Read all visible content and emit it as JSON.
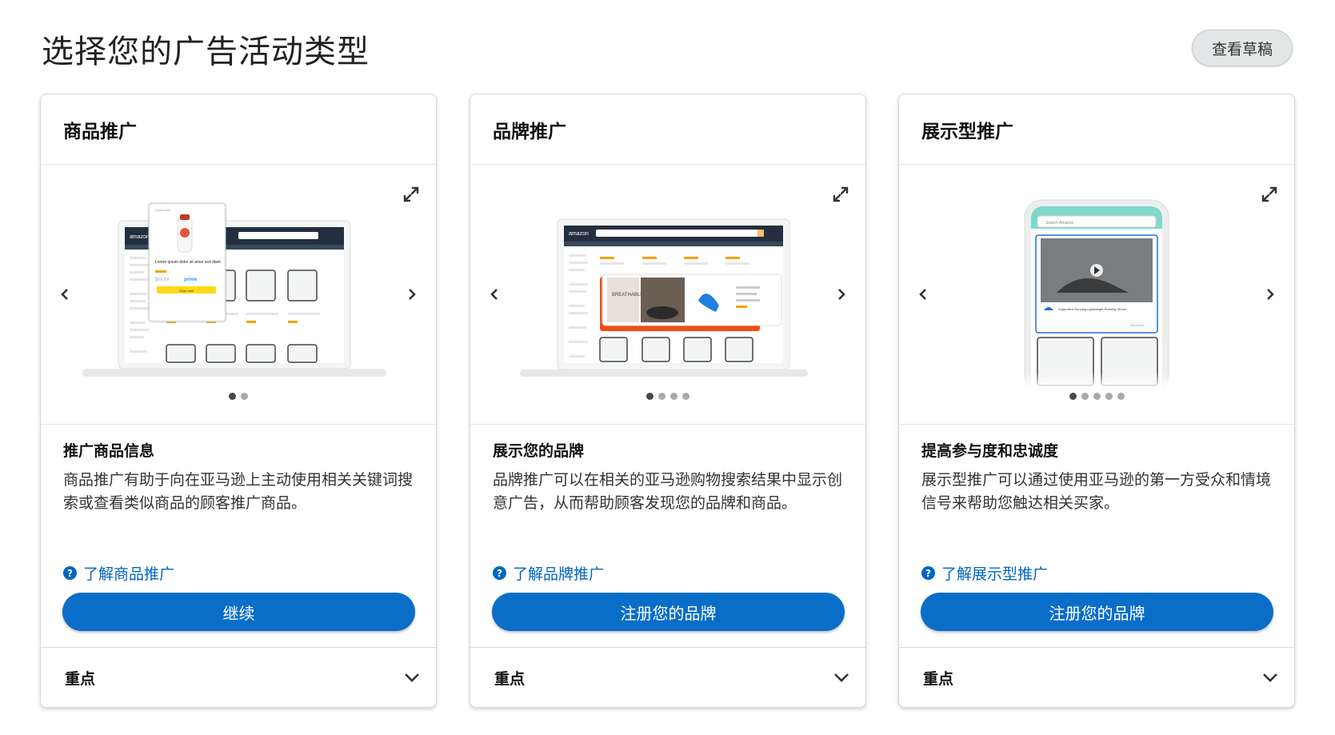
{
  "page": {
    "title": "选择您的广告活动类型",
    "draft_button": "查看草稿"
  },
  "cards": [
    {
      "title": "商品推广",
      "subtitle": "推广商品信息",
      "description": "商品推广有助于向在亚马逊上主动使用相关关键词搜索或查看类似商品的顾客推广商品。",
      "learn_link": "了解商品推广",
      "button": "继续",
      "footer": "重点",
      "slides": 2,
      "active_slide": 0,
      "illustration": {
        "product_label": "Sponsored",
        "product_name": "Lorem ipsum dolor sit amet sed diam",
        "price": "$XX.XX",
        "prime": "prime",
        "button": "Shop now",
        "brand": "amazon"
      }
    },
    {
      "title": "品牌推广",
      "subtitle": "展示您的品牌",
      "description": "品牌推广可以在相关的亚马逊购物搜索结果中显示创意广告，从而帮助顾客发现您的品牌和商品。",
      "learn_link": "了解品牌推广",
      "button": "注册您的品牌",
      "footer": "重点",
      "slides": 4,
      "active_slide": 0,
      "illustration": {
        "brand": "amazon",
        "headline": "BREATHABLE COMFORT"
      }
    },
    {
      "title": "展示型推广",
      "subtitle": "提高参与度和忠诚度",
      "description": "展示型推广可以通过使用亚马逊的第一方受众和情境信号来帮助您触达相关买家。",
      "learn_link": "了解展示型推广",
      "button": "注册您的品牌",
      "footer": "重点",
      "slides": 5,
      "active_slide": 0,
      "illustration": {
        "search_placeholder": "Search Amazon",
        "product_name": "Supportive Running Lightweight Running Shoes",
        "sponsored": "Sponsored"
      }
    }
  ],
  "colors": {
    "primary": "#0a6ec9",
    "link": "#0066c0",
    "orange": "#f04e12",
    "teal": "#7fd8cc"
  },
  "icons": {
    "expand": "expand-icon",
    "prev": "chevron-left-icon",
    "next": "chevron-right-icon",
    "help": "help-circle-icon",
    "chevron_down": "chevron-down-icon"
  }
}
